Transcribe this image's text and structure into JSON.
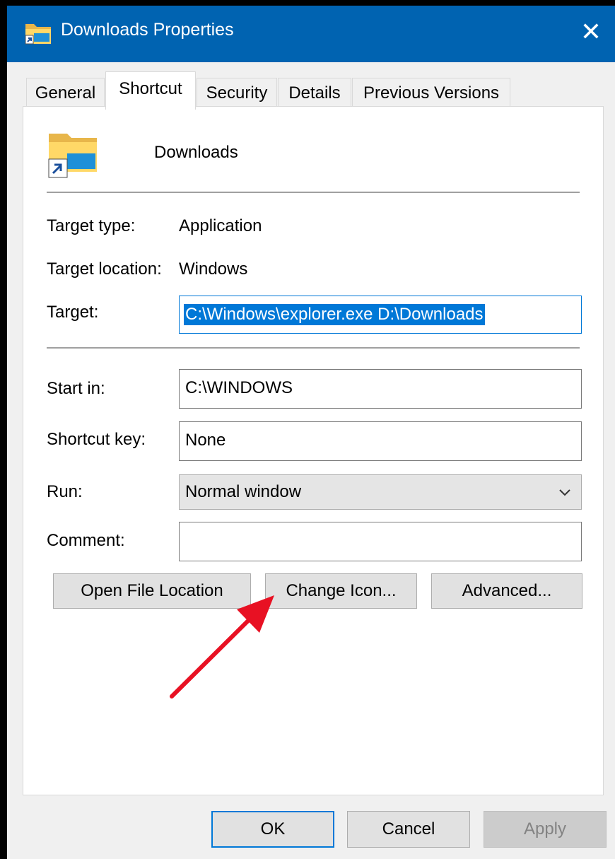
{
  "window": {
    "title": "Downloads Properties",
    "close_glyph": "✕",
    "icon": "folder-shortcut-icon"
  },
  "tabs": [
    {
      "label": "General",
      "active": false
    },
    {
      "label": "Shortcut",
      "active": true
    },
    {
      "label": "Security",
      "active": false
    },
    {
      "label": "Details",
      "active": false
    },
    {
      "label": "Previous Versions",
      "active": false
    }
  ],
  "shortcut": {
    "name": "Downloads",
    "icon": "folder-shortcut-icon",
    "target_type_label": "Target type:",
    "target_type_value": "Application",
    "target_location_label": "Target location:",
    "target_location_value": "Windows",
    "target_label": "Target:",
    "target_value": "C:\\Windows\\explorer.exe D:\\Downloads",
    "start_in_label": "Start in:",
    "start_in_value": "C:\\WINDOWS",
    "shortcut_key_label": "Shortcut key:",
    "shortcut_key_value": "None",
    "run_label": "Run:",
    "run_value": "Normal window",
    "comment_label": "Comment:",
    "comment_value": ""
  },
  "actions": {
    "open_file_location": "Open File Location",
    "change_icon": "Change Icon...",
    "advanced": "Advanced..."
  },
  "footer": {
    "ok": "OK",
    "cancel": "Cancel",
    "apply": "Apply",
    "apply_enabled": false
  },
  "annotation": {
    "arrow_color": "#e81123",
    "points_to": "change-icon-button"
  },
  "colors": {
    "titlebar": "#0063b1",
    "accent": "#0078d7"
  }
}
